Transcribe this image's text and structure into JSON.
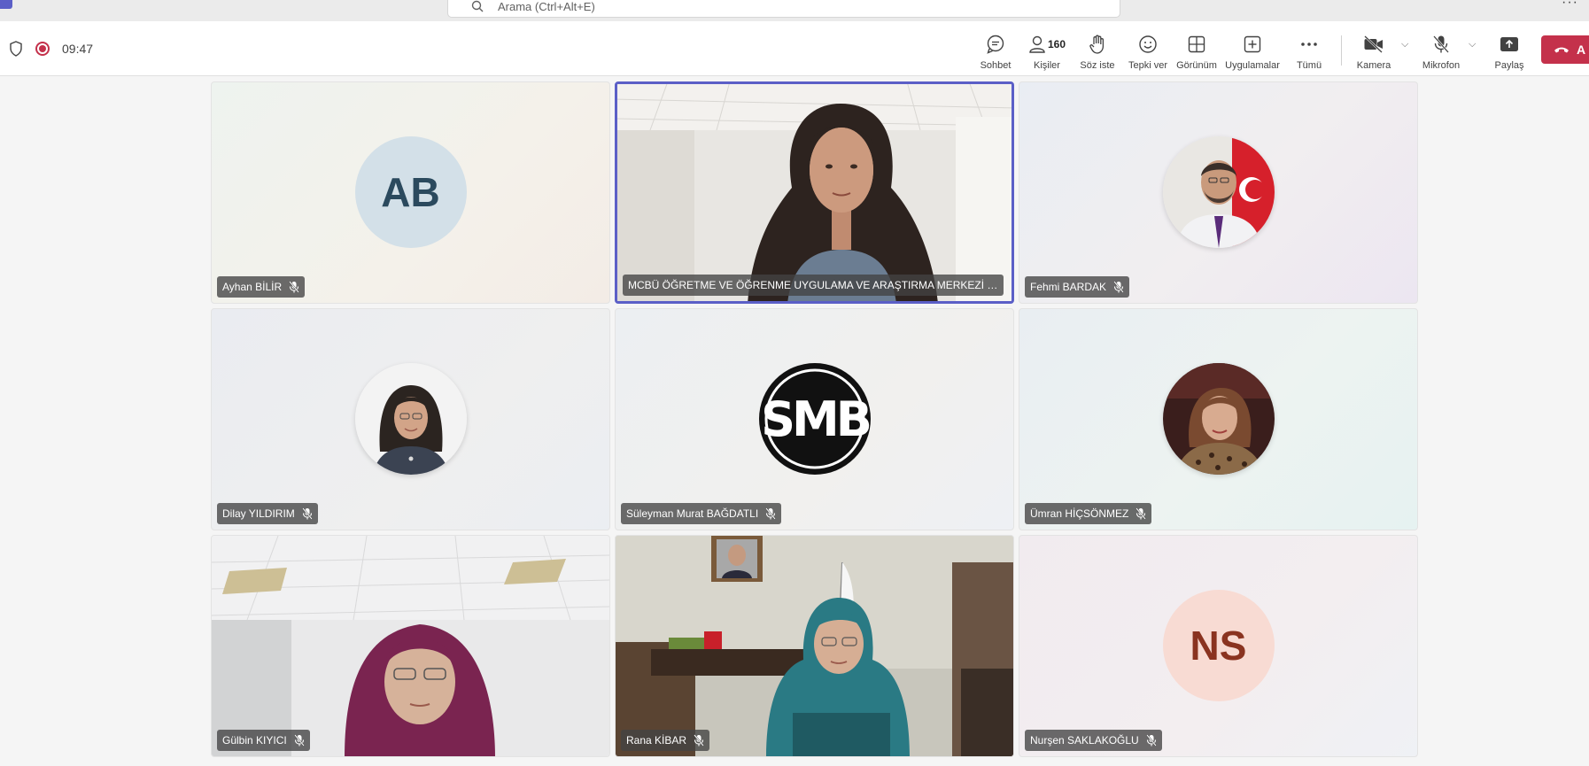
{
  "search": {
    "placeholder": "Arama (Ctrl+Alt+E)"
  },
  "meeting": {
    "timer": "09:47"
  },
  "toolbar": {
    "chat": "Sohbet",
    "people": "Kişiler",
    "people_count": "160",
    "raise_hand": "Söz iste",
    "react": "Tepki ver",
    "view": "Görünüm",
    "apps": "Uygulamalar",
    "more": "Tümü",
    "camera": "Kamera",
    "mic": "Mikrofon",
    "share": "Paylaş",
    "leave": "A"
  },
  "participants": [
    {
      "name": "Ayhan BİLİR",
      "initials": "AB"
    },
    {
      "name": "MCBÜ ÖĞRETME VE ÖĞRENME UYGULAMA VE ARAŞTIRMA MERKEZİ MÜD..."
    },
    {
      "name": "Fehmi BARDAK"
    },
    {
      "name": "Dilay YILDIRIM"
    },
    {
      "name": "Süleyman Murat BAĞDATLI",
      "logo_text": "SMB"
    },
    {
      "name": "Ümran HİÇSÖNMEZ"
    },
    {
      "name": "Gülbin KIYICI"
    },
    {
      "name": "Rana KİBAR"
    },
    {
      "name": "Nurşen SAKLAKOĞLU",
      "initials": "NS"
    }
  ],
  "colors": {
    "accent": "#5b5fc7",
    "leave": "#c4314b",
    "recording": "#c4314b"
  }
}
